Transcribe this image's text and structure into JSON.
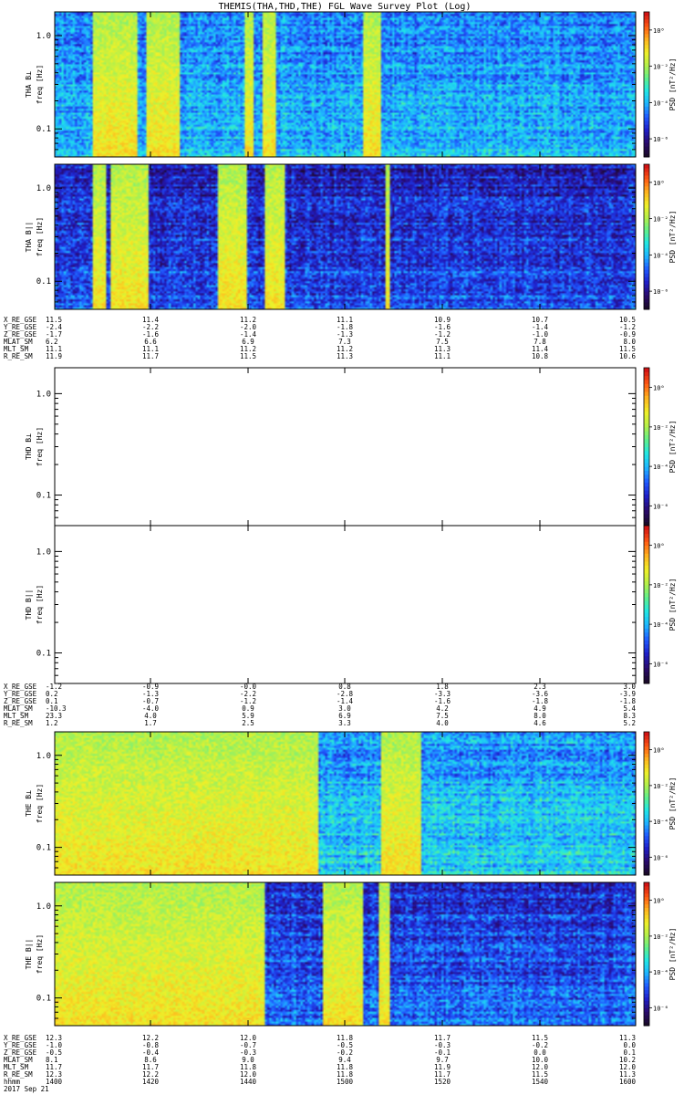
{
  "title": "THEMIS(THA,THD,THE) FGL Wave Survey Plot (Log)",
  "colors": {
    "colormap": [
      "#1a0a2a",
      "#2a0a6e",
      "#1f1fc8",
      "#1f5aff",
      "#1fb4ff",
      "#20e6e6",
      "#5ef08c",
      "#b4f04a",
      "#f0f028",
      "#ffb41e",
      "#ff5a14",
      "#d21414"
    ]
  },
  "chart_data": [
    {
      "type": "heatmap",
      "probe": "THA",
      "title": "THEMIS(THA,THD,THE) FGL Wave Survey Plot (Log)",
      "ylabel": "THA B⊥",
      "yunit": "freq [Hz]",
      "yscale": "log",
      "ylim": [
        0.05,
        1.8
      ],
      "yticks": [
        "1.0",
        "0.1"
      ],
      "colorbar_label": "PSD [nT²/Hz]",
      "colorbar_ticks": [
        "10⁰",
        "10⁻²",
        "10⁻⁴",
        "10⁻⁶"
      ],
      "colorbar_range_log10": [
        -7,
        1
      ],
      "bright_bands_fraction_of_span": [
        [
          0.065,
          0.14
        ],
        [
          0.155,
          0.215
        ],
        [
          0.325,
          0.34
        ],
        [
          0.355,
          0.38
        ],
        [
          0.53,
          0.56
        ]
      ],
      "background_level_log10": -4.2
    },
    {
      "type": "heatmap",
      "probe": "THA",
      "ylabel": "THA B||",
      "yunit": "freq [Hz]",
      "yscale": "log",
      "ylim": [
        0.05,
        1.8
      ],
      "yticks": [
        "1.0",
        "0.1"
      ],
      "colorbar_label": "PSD [nT²/Hz]",
      "colorbar_ticks": [
        "10⁰",
        "10⁻²",
        "10⁻⁴",
        "10⁻⁶"
      ],
      "colorbar_range_log10": [
        -7,
        1
      ],
      "bright_bands_fraction_of_span": [
        [
          0.065,
          0.085
        ],
        [
          0.095,
          0.16
        ],
        [
          0.28,
          0.33
        ],
        [
          0.36,
          0.395
        ],
        [
          0.568,
          0.575
        ]
      ],
      "background_level_log10": -5.3
    },
    {
      "type": "heatmap",
      "probe": "THD",
      "ylabel": "THD B⊥",
      "yunit": "freq [Hz]",
      "yscale": "log",
      "ylim": [
        0.05,
        1.8
      ],
      "yticks": [
        "1.0",
        "0.1"
      ],
      "colorbar_label": "PSD [nT²/Hz]",
      "colorbar_ticks": [
        "10⁰",
        "10⁻²",
        "10⁻⁴",
        "10⁻⁶"
      ],
      "colorbar_range_log10": [
        -7,
        1
      ],
      "empty": true
    },
    {
      "type": "heatmap",
      "probe": "THD",
      "ylabel": "THD B||",
      "yunit": "freq [Hz]",
      "yscale": "log",
      "ylim": [
        0.05,
        1.8
      ],
      "yticks": [
        "1.0",
        "0.1"
      ],
      "colorbar_label": "PSD [nT²/Hz]",
      "colorbar_ticks": [
        "10⁰",
        "10⁻²",
        "10⁻⁴",
        "10⁻⁶"
      ],
      "colorbar_range_log10": [
        -7,
        1
      ],
      "empty": true
    },
    {
      "type": "heatmap",
      "probe": "THE",
      "ylabel": "THE B⊥",
      "yunit": "freq [Hz]",
      "yscale": "log",
      "ylim": [
        0.05,
        1.8
      ],
      "yticks": [
        "1.0",
        "0.1"
      ],
      "colorbar_label": "PSD [nT²/Hz]",
      "colorbar_ticks": [
        "10⁰",
        "10⁻²",
        "10⁻⁴",
        "10⁻⁶"
      ],
      "colorbar_range_log10": [
        -7,
        1
      ],
      "bright_bands_fraction_of_span": [
        [
          0.0,
          0.45
        ],
        [
          0.56,
          0.63
        ]
      ],
      "background_level_log10": -4.0
    },
    {
      "type": "heatmap",
      "probe": "THE",
      "ylabel": "THE B||",
      "yunit": "freq [Hz]",
      "yscale": "log",
      "ylim": [
        0.05,
        1.8
      ],
      "yticks": [
        "1.0",
        "0.1"
      ],
      "colorbar_label": "PSD [nT²/Hz]",
      "colorbar_ticks": [
        "10⁰",
        "10⁻²",
        "10⁻⁴",
        "10⁻⁶"
      ],
      "colorbar_range_log10": [
        -7,
        1
      ],
      "bright_bands_fraction_of_span": [
        [
          0.0,
          0.36
        ],
        [
          0.46,
          0.53
        ],
        [
          0.555,
          0.575
        ]
      ],
      "background_level_log10": -5.0
    }
  ],
  "ephemeris_tables": [
    {
      "probe": "THA",
      "rows": [
        {
          "label": "X_RE_GSE",
          "values": [
            "11.5",
            "11.4",
            "11.2",
            "11.1",
            "10.9",
            "10.7",
            "10.5"
          ]
        },
        {
          "label": "Y_RE_GSE",
          "values": [
            "-2.4",
            "-2.2",
            "-2.0",
            "-1.8",
            "-1.6",
            "-1.4",
            "-1.2"
          ]
        },
        {
          "label": "Z_RE_GSE",
          "values": [
            "-1.7",
            "-1.6",
            "-1.4",
            "-1.3",
            "-1.2",
            "-1.0",
            "-0.9"
          ]
        },
        {
          "label": "MLAT_SM",
          "values": [
            "6.2",
            "6.6",
            "6.9",
            "7.3",
            "7.5",
            "7.8",
            "8.0"
          ]
        },
        {
          "label": "MLT_SM",
          "values": [
            "11.1",
            "11.1",
            "11.2",
            "11.2",
            "11.3",
            "11.4",
            "11.5"
          ]
        },
        {
          "label": "R_RE_SM",
          "values": [
            "11.9",
            "11.7",
            "11.5",
            "11.3",
            "11.1",
            "10.8",
            "10.6"
          ]
        }
      ]
    },
    {
      "probe": "THD",
      "rows": [
        {
          "label": "X_RE_GSE",
          "values": [
            "-1.2",
            "-0.9",
            "-0.0",
            "0.8",
            "1.8",
            "2.3",
            "3.0"
          ]
        },
        {
          "label": "Y_RE_GSE",
          "values": [
            "0.2",
            "-1.3",
            "-2.2",
            "-2.8",
            "-3.3",
            "-3.6",
            "-3.9"
          ]
        },
        {
          "label": "Z_RE_GSE",
          "values": [
            "0.1",
            "-0.7",
            "-1.2",
            "-1.4",
            "-1.6",
            "-1.8",
            "-1.8"
          ]
        },
        {
          "label": "MLAT_SM",
          "values": [
            "-10.3",
            "-4.0",
            "0.9",
            "3.0",
            "4.2",
            "4.9",
            "5.4"
          ]
        },
        {
          "label": "MLT_SM",
          "values": [
            "23.3",
            "4.0",
            "5.9",
            "6.9",
            "7.5",
            "8.0",
            "8.3"
          ]
        },
        {
          "label": "R_RE_SM",
          "values": [
            "1.2",
            "1.7",
            "2.5",
            "3.3",
            "4.0",
            "4.6",
            "5.2"
          ]
        }
      ]
    },
    {
      "probe": "THE",
      "rows": [
        {
          "label": "X_RE_GSE",
          "values": [
            "12.3",
            "12.2",
            "12.0",
            "11.8",
            "11.7",
            "11.5",
            "11.3"
          ]
        },
        {
          "label": "Y_RE_GSE",
          "values": [
            "-1.0",
            "-0.8",
            "-0.7",
            "-0.5",
            "-0.3",
            "-0.2",
            "0.0"
          ]
        },
        {
          "label": "Z_RE_GSE",
          "values": [
            "-0.5",
            "-0.4",
            "-0.3",
            "-0.2",
            "-0.1",
            "0.0",
            "0.1"
          ]
        },
        {
          "label": "MLAT_SM",
          "values": [
            "8.1",
            "8.6",
            "9.0",
            "9.4",
            "9.7",
            "10.0",
            "10.2"
          ]
        },
        {
          "label": "MLT_SM",
          "values": [
            "11.7",
            "11.7",
            "11.8",
            "11.8",
            "11.9",
            "12.0",
            "12.0"
          ]
        },
        {
          "label": "R_RE_SM",
          "values": [
            "12.3",
            "12.2",
            "12.0",
            "11.8",
            "11.7",
            "11.5",
            "11.3"
          ]
        },
        {
          "label": "hhmm",
          "values": [
            "1400",
            "1420",
            "1440",
            "1500",
            "1520",
            "1540",
            "1600"
          ]
        }
      ],
      "date_label": "2017 Sep 21"
    }
  ]
}
